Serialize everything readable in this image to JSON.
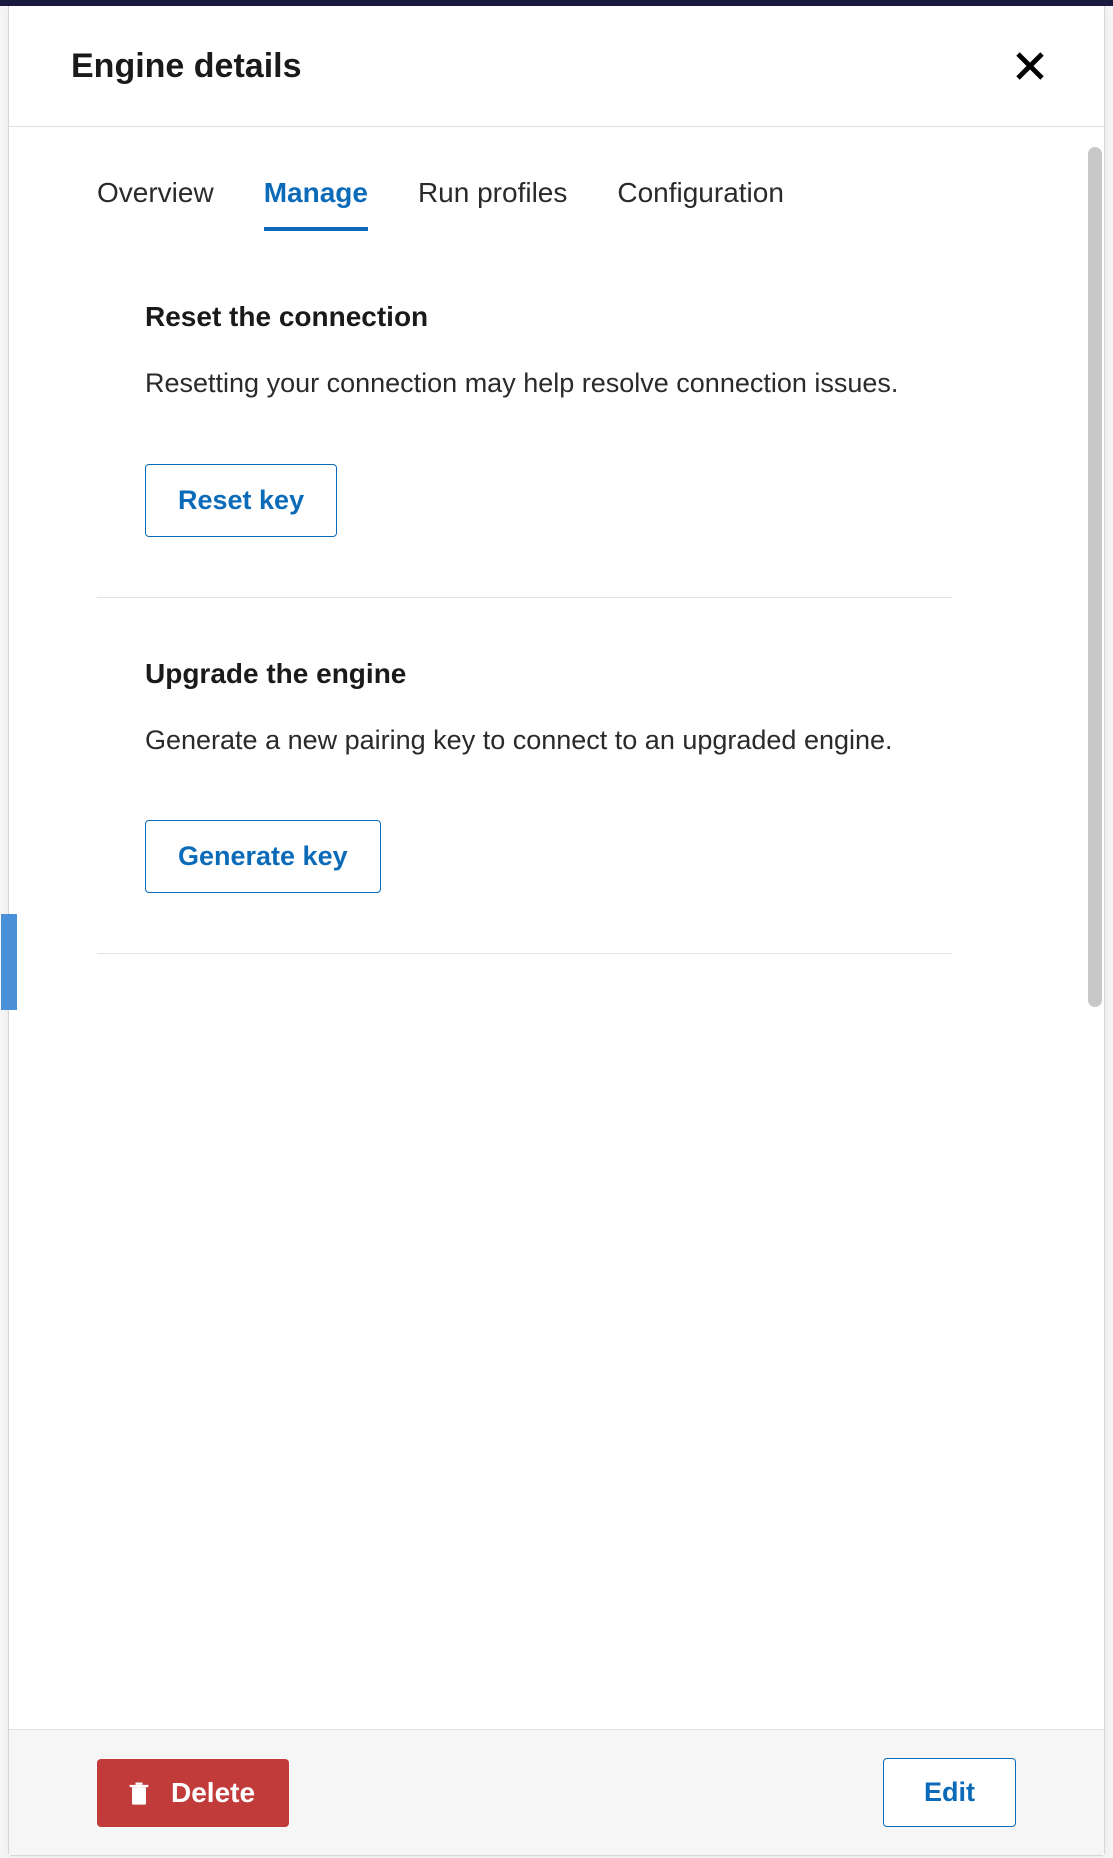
{
  "header": {
    "title": "Engine details"
  },
  "tabs": {
    "items": [
      {
        "label": "Overview",
        "active": false
      },
      {
        "label": "Manage",
        "active": true
      },
      {
        "label": "Run profiles",
        "active": false
      },
      {
        "label": "Configuration",
        "active": false
      }
    ]
  },
  "sections": {
    "reset": {
      "title": "Reset the connection",
      "description": "Resetting your connection may help resolve connection issues.",
      "button_label": "Reset key"
    },
    "upgrade": {
      "title": "Upgrade the engine",
      "description": "Generate a new pairing key to connect to an upgraded engine.",
      "button_label": "Generate key"
    }
  },
  "footer": {
    "delete_label": "Delete",
    "edit_label": "Edit"
  }
}
